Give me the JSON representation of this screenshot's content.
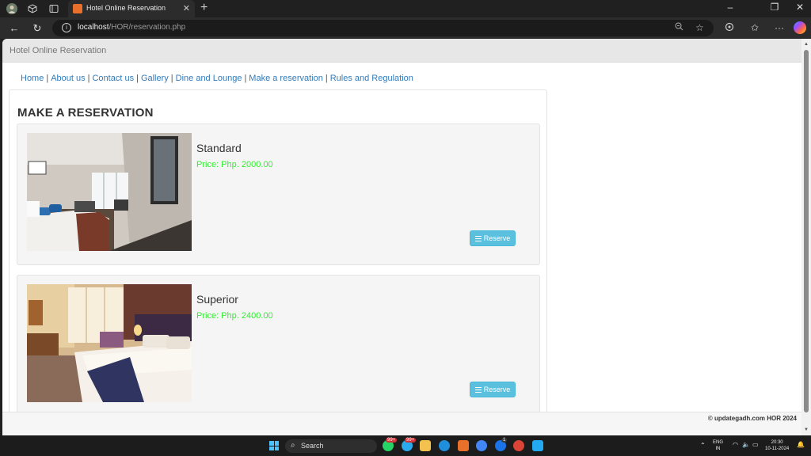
{
  "browser": {
    "tab_title": "Hotel Online Reservation",
    "url_host": "localhost",
    "url_path": "/HOR/reservation.php"
  },
  "site": {
    "brand": "Hotel Online Reservation",
    "nav": [
      {
        "label": "Home"
      },
      {
        "label": "About us"
      },
      {
        "label": "Contact us"
      },
      {
        "label": "Gallery"
      },
      {
        "label": "Dine and Lounge"
      },
      {
        "label": "Make a reservation"
      },
      {
        "label": "Rules and Regulation"
      }
    ],
    "page_title": "MAKE A RESERVATION",
    "rooms": [
      {
        "name": "Standard",
        "price": "Price: Php. 2000.00",
        "button": "Reserve"
      },
      {
        "name": "Superior",
        "price": "Price: Php. 2400.00",
        "button": "Reserve"
      }
    ],
    "footer": "© updategadh.com HOR 2024"
  },
  "taskbar": {
    "search_placeholder": "Search",
    "badge_1": "99+",
    "badge_2": "99+",
    "badge_3": "1",
    "lang_1": "ENG",
    "lang_2": "IN",
    "time": "20:30",
    "date": "10-11-2024"
  },
  "colors": {
    "link": "#337ab7",
    "price": "#33ee33",
    "reserve_button": "#5bc0de",
    "header_bg": "#e7e7e7"
  }
}
